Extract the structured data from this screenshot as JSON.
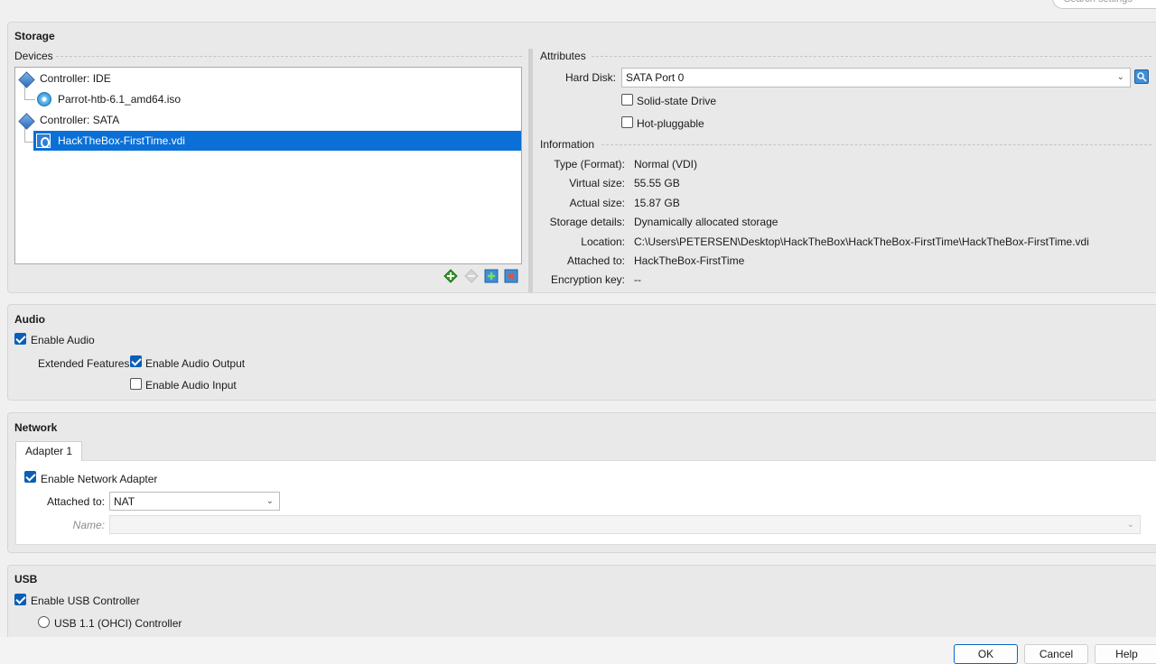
{
  "search": {
    "placeholder": "Search settings"
  },
  "storage": {
    "title": "Storage",
    "devices_label": "Devices",
    "tree": [
      {
        "label": "Controller: IDE",
        "icon": "ide-controller-icon"
      },
      {
        "label": "Parrot-htb-6.1_amd64.iso",
        "icon": "optical-disc-icon"
      },
      {
        "label": "Controller: SATA",
        "icon": "sata-controller-icon"
      },
      {
        "label": "HackTheBox-FirstTime.vdi",
        "icon": "hard-disk-icon",
        "selected": true
      }
    ],
    "toolbar": [
      "add-controller-icon",
      "remove-controller-icon",
      "add-attachment-icon",
      "remove-attachment-icon"
    ],
    "attributes_label": "Attributes",
    "hard_disk_label": "Hard Disk:",
    "hard_disk_value": "SATA Port 0",
    "ssd_label": "Solid-state Drive",
    "hotplug_label": "Hot-pluggable",
    "information_label": "Information",
    "info": [
      {
        "label": "Type (Format):",
        "value": "Normal (VDI)"
      },
      {
        "label": "Virtual size:",
        "value": "55.55 GB"
      },
      {
        "label": "Actual size:",
        "value": "15.87 GB"
      },
      {
        "label": "Storage details:",
        "value": "Dynamically allocated storage"
      },
      {
        "label": "Location:",
        "value": "C:\\Users\\PETERSEN\\Desktop\\HackTheBox\\HackTheBox-FirstTime\\HackTheBox-FirstTime.vdi"
      },
      {
        "label": "Attached to:",
        "value": "HackTheBox-FirstTime"
      },
      {
        "label": "Encryption key:",
        "value": "--"
      }
    ]
  },
  "audio": {
    "title": "Audio",
    "enable_label": "Enable Audio",
    "extended_label": "Extended Features:",
    "output_label": "Enable Audio Output",
    "input_label": "Enable Audio Input"
  },
  "network": {
    "title": "Network",
    "tab_label": "Adapter 1",
    "enable_label": "Enable Network Adapter",
    "attached_label": "Attached to:",
    "attached_value": "NAT",
    "name_label": "Name:",
    "name_value": ""
  },
  "usb": {
    "title": "USB",
    "enable_label": "Enable USB Controller",
    "usb11_label": "USB 1.1 (OHCI) Controller"
  },
  "buttons": {
    "ok": "OK",
    "cancel": "Cancel",
    "help": "Help"
  },
  "colors": {
    "accent": "#0a6fd6",
    "check": "#0a5fb8"
  }
}
